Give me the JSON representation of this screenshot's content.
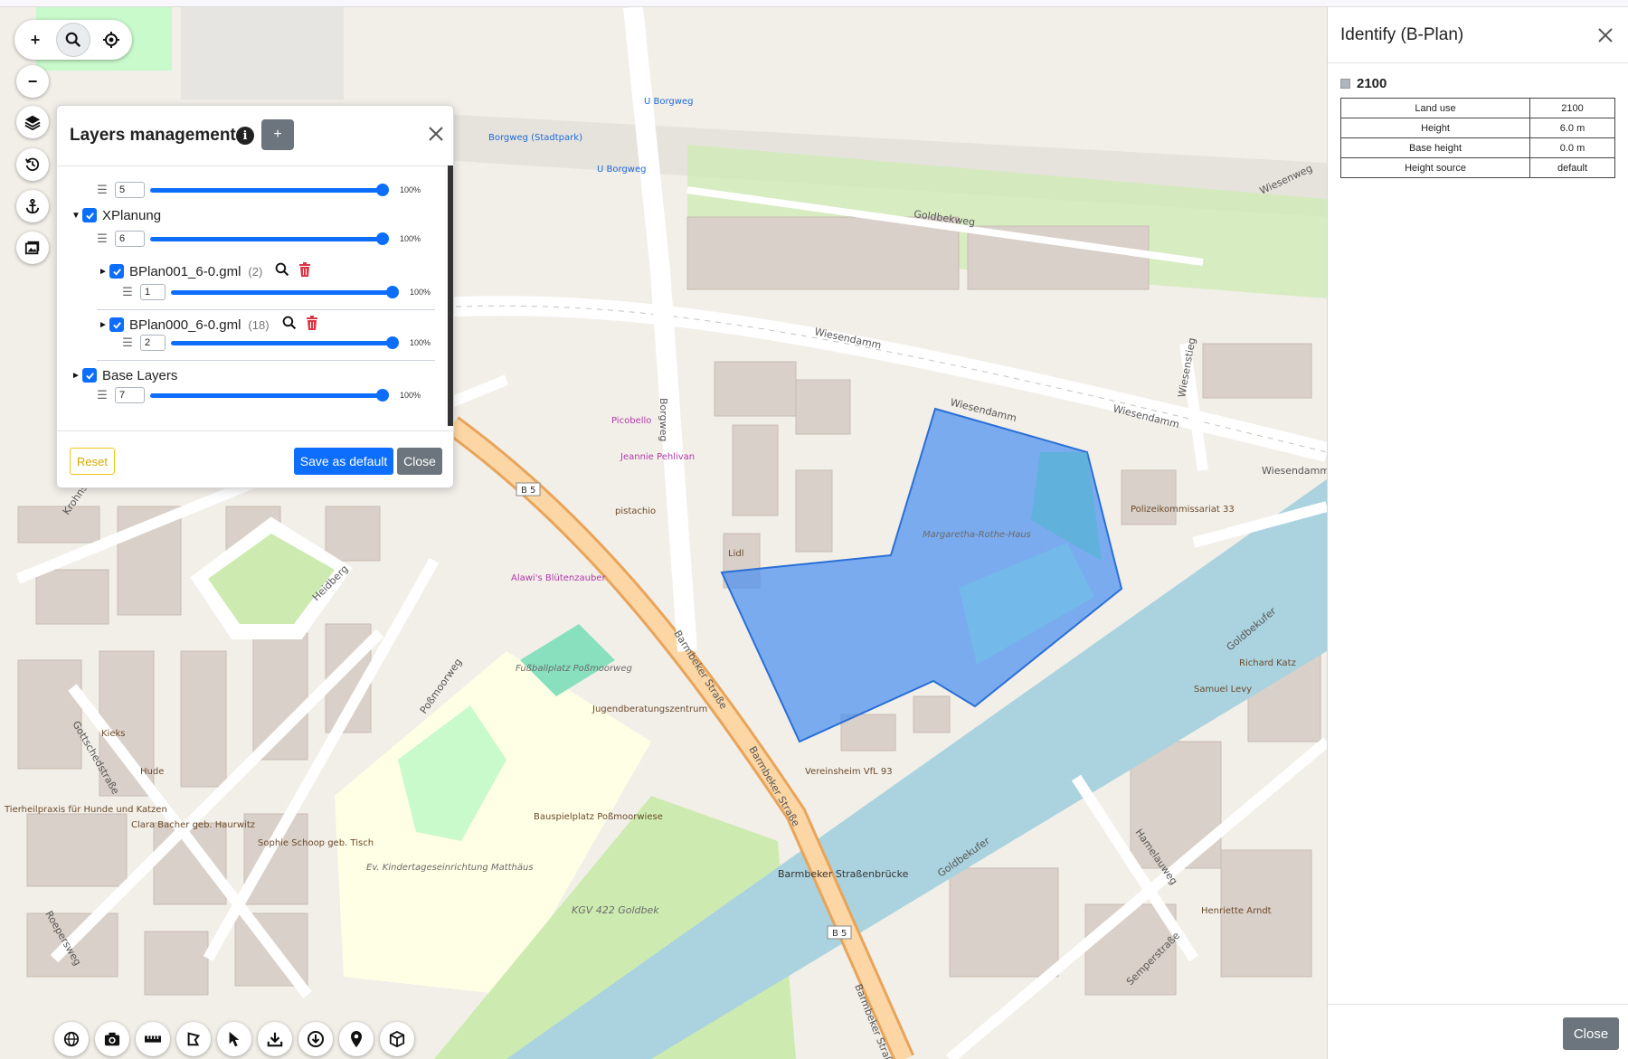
{
  "layers_panel": {
    "title": "Layers management",
    "add_label": "+",
    "rows": [
      {
        "order": "5",
        "opacity": "100%",
        "opacity_value": 1.0
      },
      {
        "name": "XPlanung",
        "order": "6",
        "opacity": "100%",
        "opacity_value": 1.0,
        "checked": true
      },
      {
        "name": "BPlan001_6-0.gml",
        "count": "(2)",
        "order": "1",
        "opacity": "100%",
        "opacity_value": 1.0,
        "checked": true
      },
      {
        "name": "BPlan000_6-0.gml",
        "count": "(18)",
        "order": "2",
        "opacity": "100%",
        "opacity_value": 1.0,
        "checked": true
      },
      {
        "name": "Base Layers",
        "order": "7",
        "opacity": "100%",
        "opacity_value": 1.0,
        "checked": true
      }
    ],
    "reset_label": "Reset",
    "save_label": "Save as default",
    "close_label": "Close"
  },
  "identify_panel": {
    "title": "Identify (B-Plan)",
    "feature_id": "2100",
    "attributes": [
      {
        "key": "Land use",
        "value": "2100"
      },
      {
        "key": "Height",
        "value": "6.0 m"
      },
      {
        "key": "Base height",
        "value": "0.0 m"
      },
      {
        "key": "Height source",
        "value": "default"
      }
    ],
    "close_label": "Close"
  },
  "map_controls": {
    "zoom_in": "+",
    "zoom_out": "−"
  },
  "map_labels": {
    "wiesendamm": "Wiesendamm",
    "barmbeker_strasse": "Barmbeker Straße",
    "borgweg": "Borgweg",
    "borgweg_station": "Borgweg (Stadtpark)",
    "u_borgweg": "U Borgweg",
    "goldbekweg": "Goldbekweg",
    "margaretha": "Margaretha-Rothe-Haus",
    "polizei": "Polizeikommissariat 33",
    "kgv": "KGV 422 Goldbek",
    "bauspielplatz": "Bauspielplatz Poßmoorwiese",
    "jugend": "Jugendberatungszentrum",
    "fussball": "Fußballplatz Poßmoorweg",
    "kita": "Ev. Kindertageseinrichtung Matthäus",
    "bruecke": "Barmbeker Straßenbrücke",
    "heidberg": "Heidberg",
    "possmoorweg": "Poßmoorweg",
    "goldbekufer": "Goldbekufer",
    "b5": "B 5",
    "pistachio": "pistachio",
    "lidl": "Lidl",
    "alawis": "Alawi's Blütenzauber",
    "picobello": "Picobello",
    "jeannie": "Jeannie Pehlivan",
    "sophie": "Sophie Schoop geb. Tisch",
    "clara": "Clara Bacher geb. Haurwitz",
    "tierheil": "Tierheilpraxis für Hunde und Katzen",
    "vereinsheim": "Vereinsheim VfL 93",
    "hude": "Hude",
    "kieks": "Kieks",
    "richard": "Richard Katz",
    "samuel": "Samuel Levy",
    "henriette": "Henriette Arndt",
    "krohnskamp": "Krohnskamp",
    "gottschedstrasse": "Gottschedstraße",
    "roeperswег": "Roepersweg",
    "hamelauweg": "Hamelauweg",
    "semperstrasse": "Semperstraße",
    "wiesenstieg": "Wiesenstieg",
    "wiesenweg": "Wiesenweg"
  },
  "colors": {
    "accent": "#0d6efd",
    "polygon_fill": "#4a90f0",
    "canal": "#aad3df",
    "main_road": "#fcd6a4"
  }
}
